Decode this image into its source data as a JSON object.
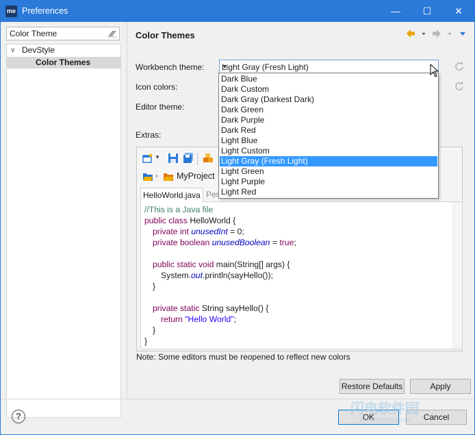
{
  "window": {
    "app_icon_text": "me",
    "title": "Preferences",
    "minimize_glyph": "—",
    "maximize_glyph": "☐",
    "close_glyph": "✕"
  },
  "sidebar": {
    "filter_value": "Color Theme",
    "items": [
      {
        "label": "DevStyle",
        "expanded": true
      },
      {
        "label": "Color Themes",
        "selected": true
      }
    ]
  },
  "page": {
    "title": "Color Themes",
    "workbench_theme_label": "Workbench theme:",
    "workbench_theme_value": "Light Gray (Fresh Light)",
    "icon_colors_label": "Icon colors:",
    "editor_theme_label": "Editor theme:",
    "extras_label": "Extras:",
    "note": "Note: Some editors must be reopened to reflect new colors",
    "restore_defaults_label": "Restore Defaults",
    "apply_label": "Apply"
  },
  "theme_options": [
    "Dark Blue",
    "Dark Custom",
    "Dark Gray (Darkest Dark)",
    "Dark Green",
    "Dark Purple",
    "Dark Red",
    "Light Blue",
    "Light Custom",
    "Light Gray (Fresh Light)",
    "Light Green",
    "Light Purple",
    "Light Red"
  ],
  "selected_option_index": 8,
  "preview": {
    "breadcrumb_project": "MyProject",
    "tab_active": "HelloWorld.java",
    "tab_inactive": "Pers",
    "code": {
      "l1": "//This is a Java file",
      "l2_kw": "public class",
      "l2_rest": " HelloWorld {",
      "l3_kw": "private int",
      "l3_field": "unusedInt",
      "l3_rest": " = 0;",
      "l4_kw": "private boolean",
      "l4_field": "unusedBoolean",
      "l4_eq": " = ",
      "l4_kw2": "true",
      "l4_end": ";",
      "l6_kw": "public static void",
      "l6_rest": " main(String[] args) {",
      "l7_a": "System.",
      "l7_field": "out",
      "l7_b": ".println(sayHello());",
      "l8": "}",
      "l10_kw": "private static",
      "l10_rest": " String sayHello() {",
      "l11_kw": "return",
      "l11_str": "\"Hello World\"",
      "l11_end": ";",
      "l12": "}",
      "l13": "}"
    }
  },
  "footer": {
    "help_glyph": "?",
    "ok_label": "OK",
    "cancel_label": "Cancel"
  },
  "watermark": {
    "line1": "闪电软件园",
    "line2": "www.sdbeta.com"
  },
  "colors": {
    "titlebar": "#2b79d8",
    "selection": "#3399ff",
    "nav_back": "#e8a200",
    "nav_dropdown": "#2b79d8"
  }
}
